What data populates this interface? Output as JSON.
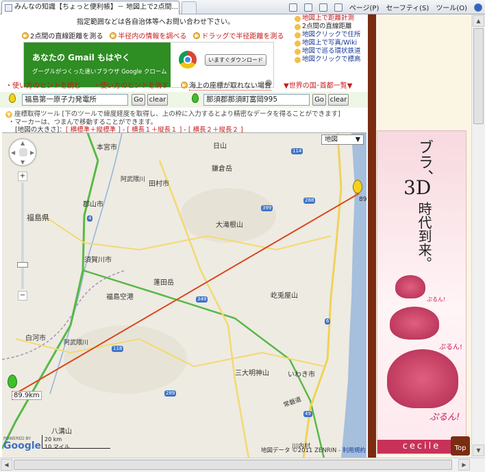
{
  "browser": {
    "tab_title": "みんなの知識【ちょっと便利帳】－ 地図上で2点間...",
    "commands": [
      "ページ(P)",
      "セーフティ(S)",
      "ツール(O)"
    ]
  },
  "top": {
    "notice": "指定範囲などは各自治体等へお問い合わせ下さい。",
    "buttons": [
      "2点間の直線距離を測る",
      "半径内の情報を調べる",
      "ドラッグで半径距離を測る"
    ],
    "right_links": [
      "地図上で距離計測",
      "2点間の直線距離",
      "地図クリックで住所",
      "地図上で写真/Wiki",
      "地図で巡る環状鉄道",
      "地図クリックで標高"
    ]
  },
  "ad": {
    "headline": "あなたの Gmail もはやく",
    "sub": "グーグルがつくった速いブラウザ Google クローム",
    "button": "いますぐダウンロード"
  },
  "hints": {
    "a": "使い方のヒントを読む",
    "b": "使い方のヒントを消す",
    "c": "海上の座標が取れない場合",
    "d": "世界の国･首都一覧"
  },
  "search": {
    "from_value": "福島第一原子力発電所",
    "to_value": "那須郡那須町富岡995",
    "go": "Go",
    "clear": "clear"
  },
  "info": {
    "line1": "座標取得ツール [下のツールで緯度経度を取得し、上の枠に入力するとより精密なデータを得ることができます]",
    "line2": "・マーカーは、つまんで移動することができます。",
    "size_label": "[地図の大きさ]：",
    "size_opts": [
      "横標準＋縦標準",
      "横長１＋縦長１",
      "横長２＋縦長２"
    ]
  },
  "map": {
    "type_label": "地図",
    "labels": [
      "本宮市",
      "日山",
      "鎌倉岳",
      "阿武隈川",
      "田村市",
      "郡山市",
      "福島県",
      "大滝根山",
      "須賀川市",
      "蓬田岳",
      "福島空港",
      "屹兎屋山",
      "白河市",
      "阿武隈川",
      "三大明神山",
      "いわき市",
      "八溝山",
      "川内村",
      "常磐道"
    ],
    "distance": "89.9km",
    "distance_end": "89",
    "scale_km": "20 km",
    "scale_mi": "10 マイル",
    "copyright": "地図データ ©2011 ZENRIN -",
    "terms": "利用規約",
    "powered": "POWERED BY",
    "google": "Google",
    "routes": [
      "114",
      "4",
      "288",
      "399",
      "349",
      "118",
      "6",
      "49",
      "289"
    ]
  },
  "bra": {
    "line1": "ブラ、",
    "line2": "3D",
    "line3": "時代到来。",
    "puru1": "ぷるん!",
    "puru2": "ぷるん!",
    "puru3": "ぷるん!",
    "brand": "cecile",
    "top": "Top"
  },
  "colors": {
    "route": "#d8471c",
    "ad_green": "#2e8d23",
    "sep": "#7a2d12"
  }
}
